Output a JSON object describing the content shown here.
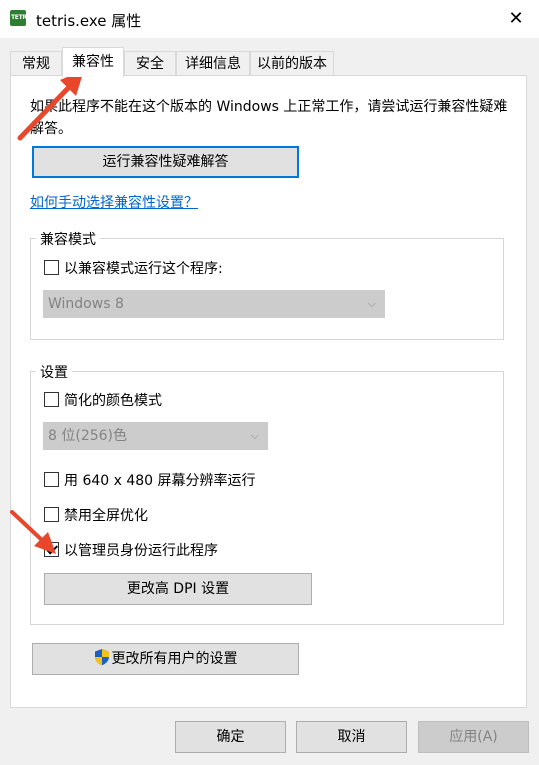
{
  "window": {
    "title": "tetris.exe 属性",
    "icon_text": "TETRIS"
  },
  "tabs": [
    {
      "label": "常规"
    },
    {
      "label": "兼容性"
    },
    {
      "label": "安全"
    },
    {
      "label": "详细信息"
    },
    {
      "label": "以前的版本"
    }
  ],
  "compat": {
    "description": "如果此程序不能在这个版本的 Windows 上正常工作，请尝试运行兼容性疑难解答。",
    "troubleshoot_button": "运行兼容性疑难解答",
    "manual_link": "如何手动选择兼容性设置？"
  },
  "compat_mode": {
    "group_label": "兼容模式",
    "checkbox_label": "以兼容模式运行这个程序:",
    "checked": false,
    "os_select_value": "Windows 8"
  },
  "settings": {
    "group_label": "设置",
    "reduced_color_label": "简化的颜色模式",
    "reduced_color_checked": false,
    "color_select_value": "8 位(256)色",
    "res_640_label": "用 640 x 480 屏幕分辨率运行",
    "res_640_checked": false,
    "disable_fullscreen_label": "禁用全屏优化",
    "disable_fullscreen_checked": false,
    "run_admin_label": "以管理员身份运行此程序",
    "run_admin_checked": true,
    "dpi_button": "更改高 DPI 设置"
  },
  "all_users_button": "更改所有用户的设置",
  "footer": {
    "ok": "确定",
    "cancel": "取消",
    "apply": "应用(A)"
  },
  "colors": {
    "accent": "#0078d7",
    "arrow": "#e8472c",
    "link": "#0066cc"
  }
}
